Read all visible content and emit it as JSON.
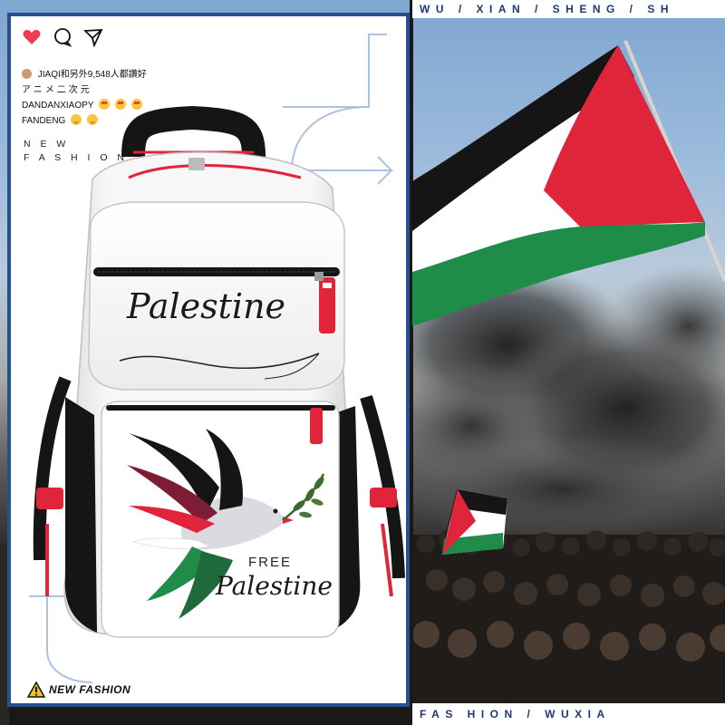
{
  "header_ticker": "WU / XIAN / SHENG / SH",
  "footer_ticker": "FAS HION / WUXIA",
  "post": {
    "like_icon": "heart-icon",
    "comment_icon": "comment-icon",
    "share_icon": "send-icon",
    "likes_line": "JIAQI和另外9,548人都讚好",
    "comments": [
      "アニメ二次元",
      "DANDANXIAOPY",
      "FANDENG"
    ]
  },
  "side_label": [
    "N E W",
    "F A S H I O N"
  ],
  "badge_label": "NEW FASHION",
  "product": {
    "front_pocket_text": "Palestine",
    "panel_text_top": "FREE",
    "panel_text_bottom": "Palestine"
  },
  "colors": {
    "frame_blue": "#274f92",
    "flag_green": "#1f8c4a",
    "flag_red": "#e0243a",
    "flag_black": "#151515",
    "zip_red": "#e0243a"
  }
}
